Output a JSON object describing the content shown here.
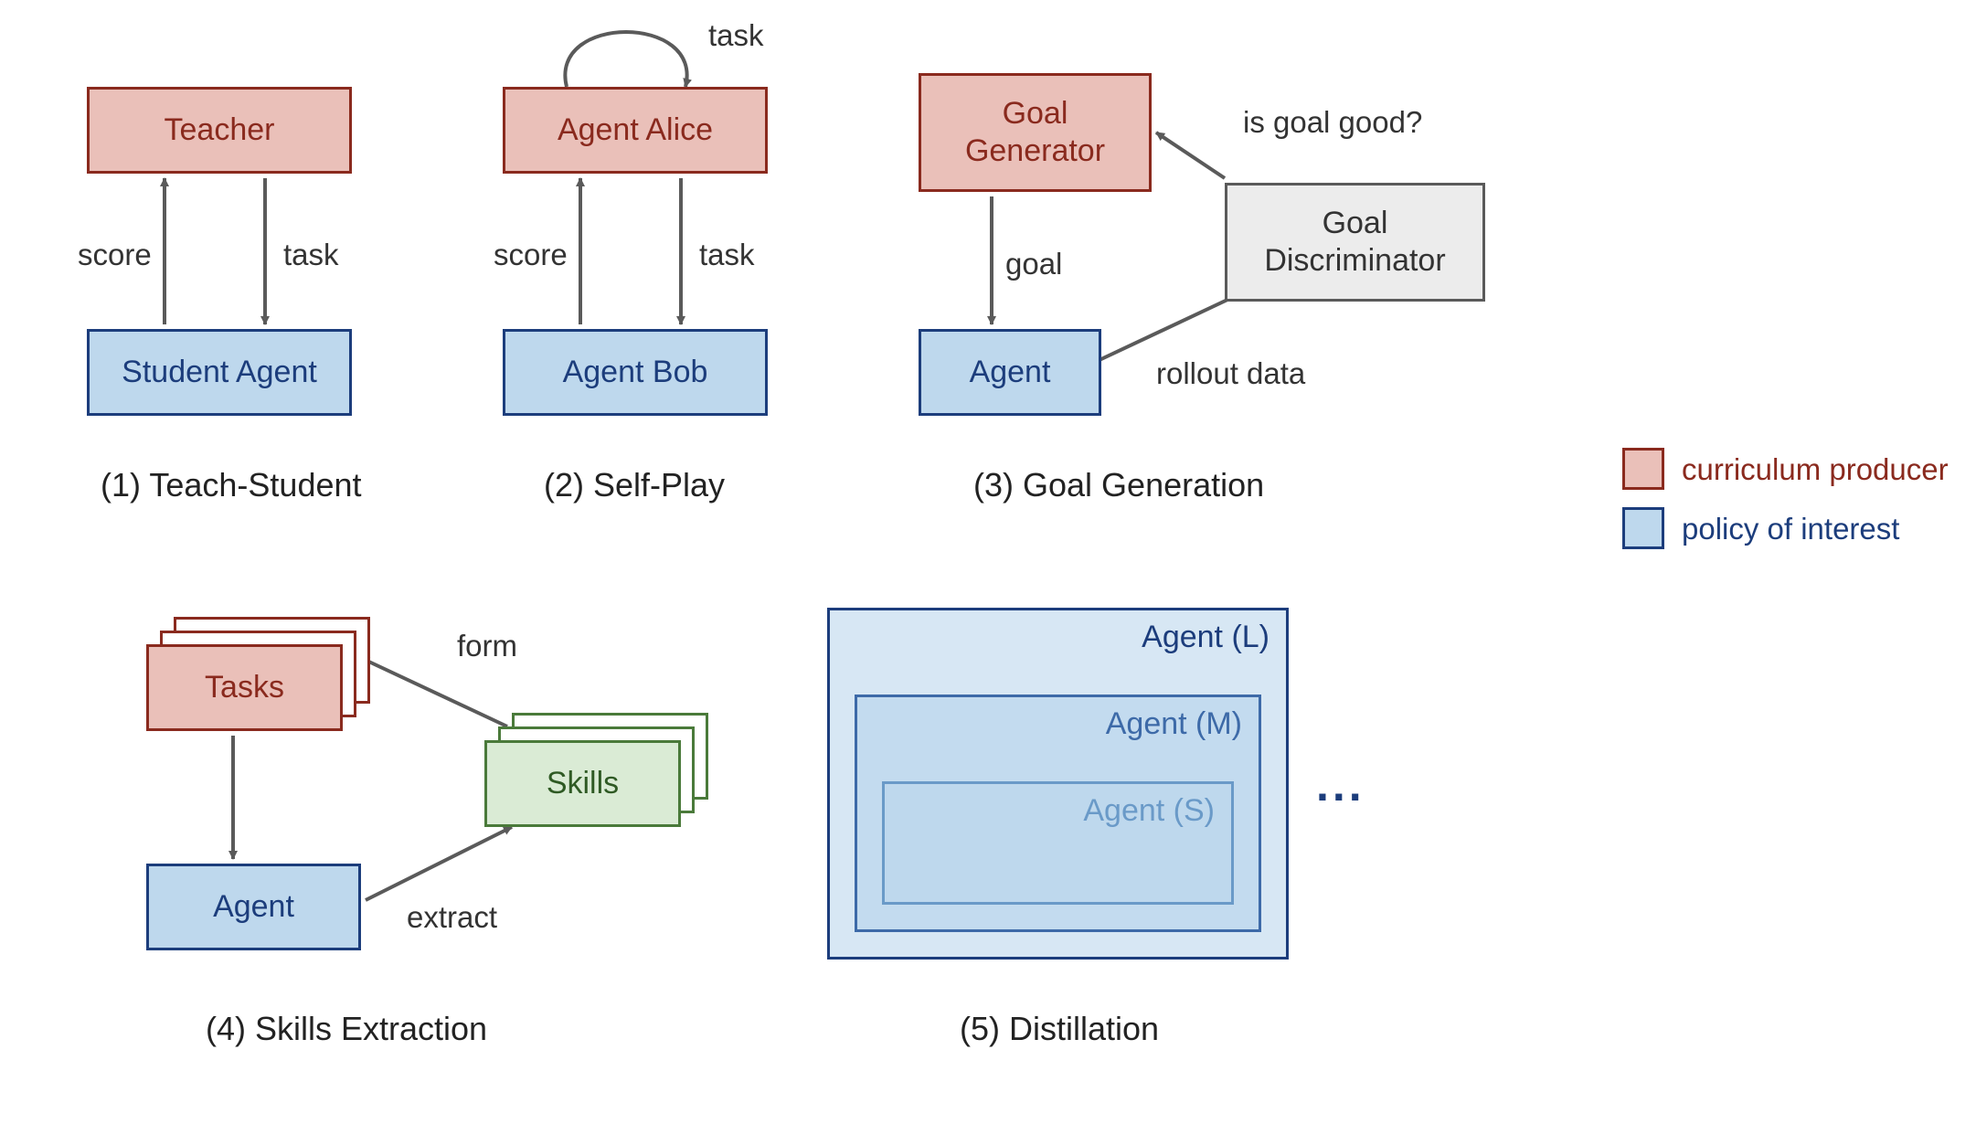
{
  "panels": {
    "p1": {
      "teacher": "Teacher",
      "student": "Student Agent",
      "score": "score",
      "task": "task",
      "caption": "(1) Teach-Student"
    },
    "p2": {
      "alice": "Agent Alice",
      "bob": "Agent Bob",
      "score": "score",
      "task": "task",
      "self_task": "task",
      "caption": "(2) Self-Play"
    },
    "p3": {
      "gen": "Goal\nGenerator",
      "disc": "Goal\nDiscriminator",
      "agent": "Agent",
      "goal": "goal",
      "rollout": "rollout data",
      "is_good": "is goal good?",
      "caption": "(3) Goal Generation"
    },
    "p4": {
      "tasks": "Tasks",
      "skills": "Skills",
      "agent": "Agent",
      "form": "form",
      "extract": "extract",
      "caption": "(4) Skills Extraction"
    },
    "p5": {
      "L": "Agent (L)",
      "M": "Agent (M)",
      "S": "Agent (S)",
      "ellipsis": "...",
      "caption": "(5) Distillation"
    }
  },
  "legend": {
    "producer": "curriculum producer",
    "policy": "policy of interest"
  }
}
